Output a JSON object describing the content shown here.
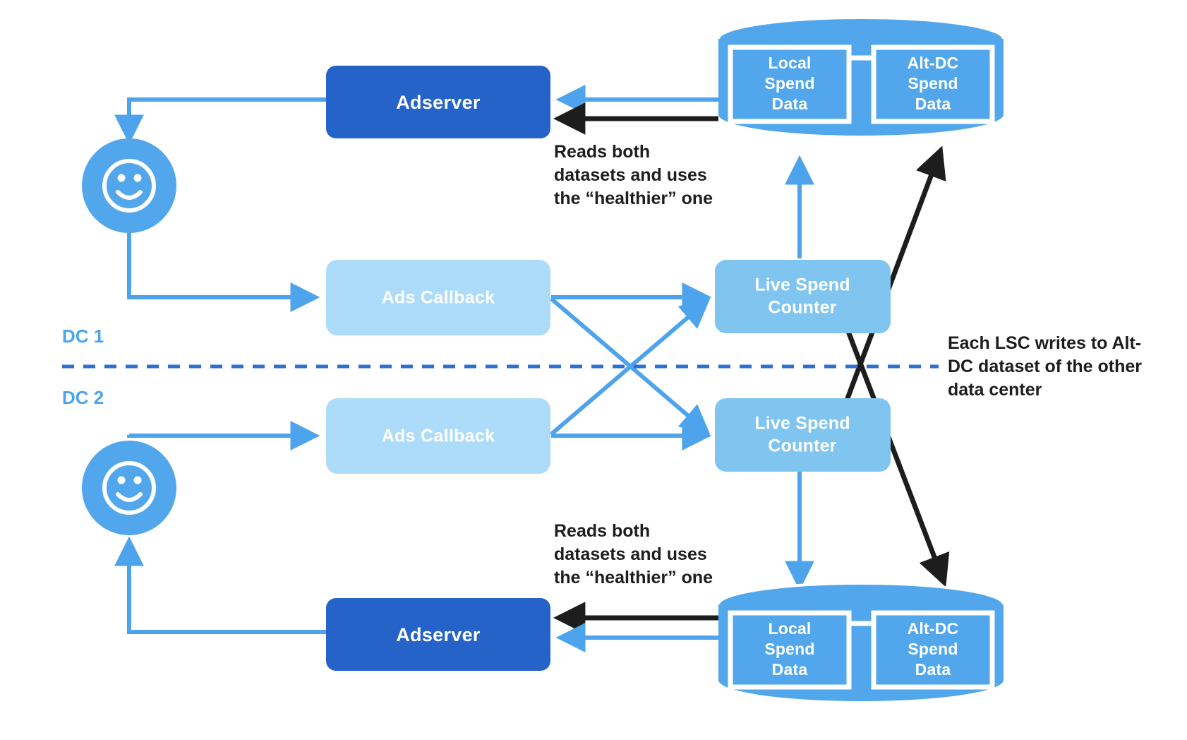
{
  "diagram": {
    "title": "Dual data center ad spend replication diagram",
    "colors": {
      "adserver_fill": "#2563C8",
      "callback_fill": "#ADDCFA",
      "lsc_fill": "#7FC5F0",
      "cylinder_fill": "#52A7EC",
      "arrow_blue": "#4EA4EC",
      "arrow_black": "#1d1d1d",
      "divider_blue": "#2E6FD4",
      "dc_label_color": "#4EA4EC",
      "text_white": "#FFFFFF",
      "text_black": "#1d1d1d",
      "background": "#FFFFFF"
    },
    "zones": [
      {
        "id": "dc1",
        "label": "DC 1"
      },
      {
        "id": "dc2",
        "label": "DC 2"
      }
    ],
    "nodes": {
      "dc1": {
        "user": {
          "name": "user-smiley",
          "icon": "smiley-face-icon"
        },
        "adserver": {
          "label": "Adserver"
        },
        "ads_callback": {
          "label": "Ads Callback"
        },
        "live_spend_counter": {
          "label_line1": "Live Spend",
          "label_line2": "Counter"
        },
        "datastore": {
          "local": {
            "line1": "Local",
            "line2": "Spend",
            "line3": "Data"
          },
          "altdc": {
            "line1": "Alt-DC",
            "line2": "Spend",
            "line3": "Data"
          }
        }
      },
      "dc2": {
        "user": {
          "name": "user-smiley",
          "icon": "smiley-face-icon"
        },
        "adserver": {
          "label": "Adserver"
        },
        "ads_callback": {
          "label": "Ads Callback"
        },
        "live_spend_counter": {
          "label_line1": "Live Spend",
          "label_line2": "Counter"
        },
        "datastore": {
          "local": {
            "line1": "Local",
            "line2": "Spend",
            "line3": "Data"
          },
          "altdc": {
            "line1": "Alt-DC",
            "line2": "Spend",
            "line3": "Data"
          }
        }
      }
    },
    "annotations": {
      "reads_top": {
        "line1": "Reads both",
        "line2": "datasets and uses",
        "line3": "the “healthier” one"
      },
      "reads_bottom": {
        "line1": "Reads both",
        "line2": "datasets and uses",
        "line3": "the “healthier” one"
      },
      "lsc_writes": {
        "line1": "Each LSC writes to Alt-",
        "line2": "DC dataset of the other",
        "line3": "data center"
      }
    }
  }
}
